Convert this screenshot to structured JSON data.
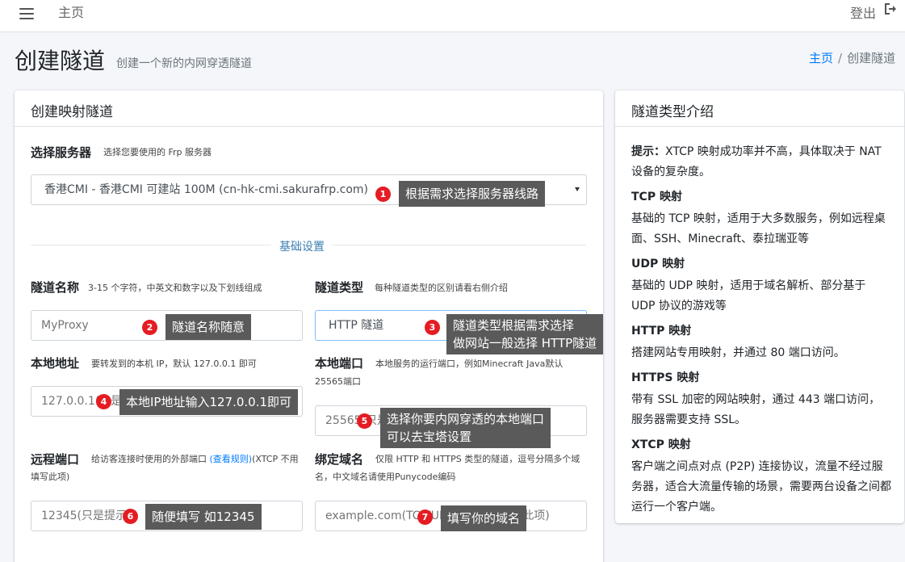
{
  "topbar": {
    "home": "主页",
    "logout": "登出"
  },
  "page": {
    "title": "创建隧道",
    "subtitle": "创建一个新的内网穿透隧道"
  },
  "breadcrumb": {
    "home": "主页",
    "sep": "/",
    "current": "创建隧道"
  },
  "form": {
    "card_title": "创建映射隧道",
    "server": {
      "label": "选择服务器",
      "hint": "选择您要使用的 Frp 服务器",
      "selected": "香港CMI - 香港CMI 可建站 100M (cn-hk-cmi.sakurafrp.com)"
    },
    "section_basic": "基础设置",
    "name": {
      "label": "隧道名称",
      "hint": "3-15 个字符，中英文和数字以及下划线组成",
      "placeholder": "MyProxy"
    },
    "type": {
      "label": "隧道类型",
      "hint": "每种隧道类型的区别请看右侧介绍",
      "selected": "HTTP 隧道"
    },
    "local_addr": {
      "label": "本地地址",
      "hint": "要转发到的本机 IP，默认 127.0.0.1 即可",
      "placeholder": "127.0.0.1(只是提示)"
    },
    "local_port": {
      "label": "本地端口",
      "hint": "本地服务的运行端口，例如Minecraft Java默认 25565端口",
      "placeholder": "25565(只是提示)"
    },
    "remote_port": {
      "label": "远程端口",
      "hint_pre": "给访客连接时使用的外部端口 ",
      "hint_link": "(查看规则)",
      "hint_post": "(XTCP 不用填写此项)",
      "placeholder": "12345(只是提示)"
    },
    "domain": {
      "label": "绑定域名",
      "hint": "仅限 HTTP 和 HTTPS 类型的隧道，逗号分隔多个域名，中文域名请使用Punycode编码",
      "placeholder": "example.com(TCP/UDP类型不用填写此项)"
    }
  },
  "annotations": [
    {
      "num": "1",
      "text": "根据需求选择服务器线路"
    },
    {
      "num": "2",
      "text": "隧道名称随意"
    },
    {
      "num": "3",
      "line1": "隧道类型根据需求选择",
      "line2": "做网站一般选择 HTTP隧道"
    },
    {
      "num": "4",
      "text": "本地IP地址输入127.0.0.1即可"
    },
    {
      "num": "5",
      "line1": "选择你要内网穿透的本地端口",
      "line2": "可以去宝塔设置"
    },
    {
      "num": "6",
      "text": "随便填写 如12345"
    },
    {
      "num": "7",
      "text": "填写你的域名"
    }
  ],
  "side": {
    "title": "隧道类型介绍",
    "tip_label": "提示：",
    "tip_text": "XTCP 映射成功率并不高，具体取决于 NAT 设备的复杂度。",
    "types": [
      {
        "name": "TCP 映射",
        "desc": "基础的 TCP 映射，适用于大多数服务，例如远程桌面、SSH、Minecraft、泰拉瑞亚等"
      },
      {
        "name": "UDP 映射",
        "desc": "基础的 UDP 映射，适用于域名解析、部分基于 UDP 协议的游戏等"
      },
      {
        "name": "HTTP 映射",
        "desc": "搭建网站专用映射，并通过 80 端口访问。"
      },
      {
        "name": "HTTPS 映射",
        "desc": "带有 SSL 加密的网站映射，通过 443 端口访问，服务器需要支持 SSL。"
      },
      {
        "name": "XTCP 映射",
        "desc": "客户端之间点对点 (P2P) 连接协议，流量不经过服务器，适合大流量传输的场景，需要两台设备之间都运行一个客户端。"
      }
    ]
  }
}
